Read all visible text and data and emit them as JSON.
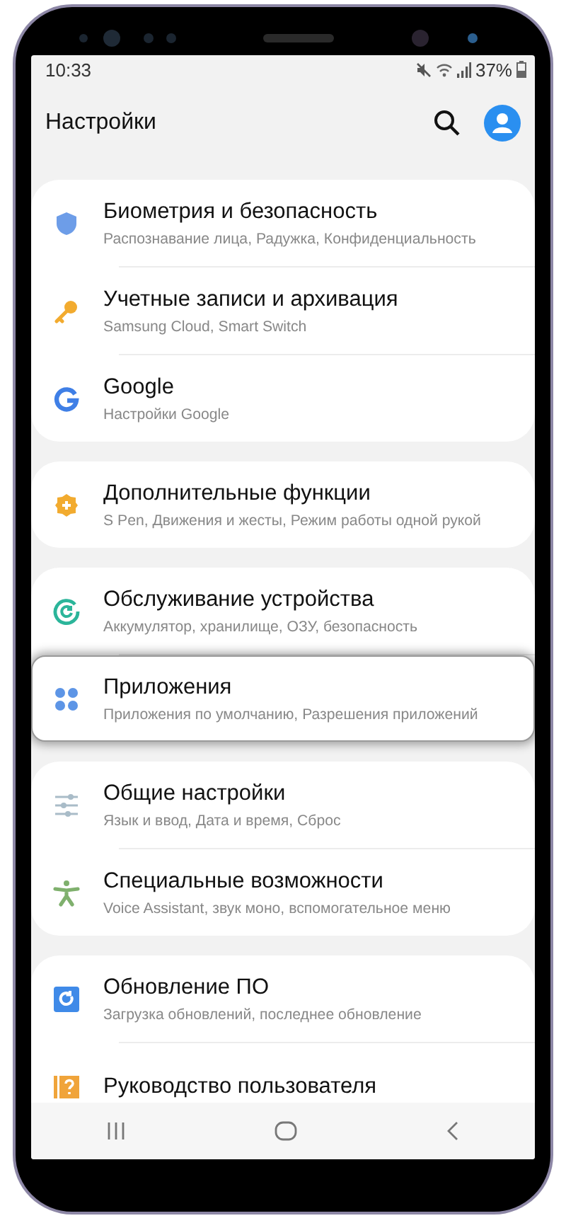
{
  "status_bar": {
    "time": "10:33",
    "battery": "37%"
  },
  "header": {
    "title": "Настройки"
  },
  "groups": [
    {
      "items": [
        {
          "title": "Биометрия и безопасность",
          "subtitle": "Распознавание лица, Радужка, Конфиденциальность",
          "selected": false
        },
        {
          "title": "Учетные записи и архивация",
          "subtitle": "Samsung Cloud, Smart Switch",
          "selected": false
        },
        {
          "title": "Google",
          "subtitle": "Настройки Google",
          "selected": false
        }
      ]
    },
    {
      "items": [
        {
          "title": "Дополнительные функции",
          "subtitle": "S Pen, Движения и жесты, Режим работы одной рукой",
          "selected": false
        }
      ]
    },
    {
      "items": [
        {
          "title": "Обслуживание устройства",
          "subtitle": "Аккумулятор, хранилище, ОЗУ, безопасность",
          "selected": false
        },
        {
          "title": "Приложения",
          "subtitle": "Приложения по умолчанию, Разрешения приложений",
          "selected": true
        }
      ]
    },
    {
      "items": [
        {
          "title": "Общие настройки",
          "subtitle": "Язык и ввод, Дата и время, Сброс",
          "selected": false
        },
        {
          "title": "Специальные возможности",
          "subtitle": "Voice Assistant, звук моно, вспомогательное меню",
          "selected": false
        }
      ]
    },
    {
      "items": [
        {
          "title": "Обновление ПО",
          "subtitle": "Загрузка обновлений, последнее обновление",
          "selected": false
        },
        {
          "title": "Руководство пользователя",
          "selected": false
        }
      ]
    }
  ]
}
